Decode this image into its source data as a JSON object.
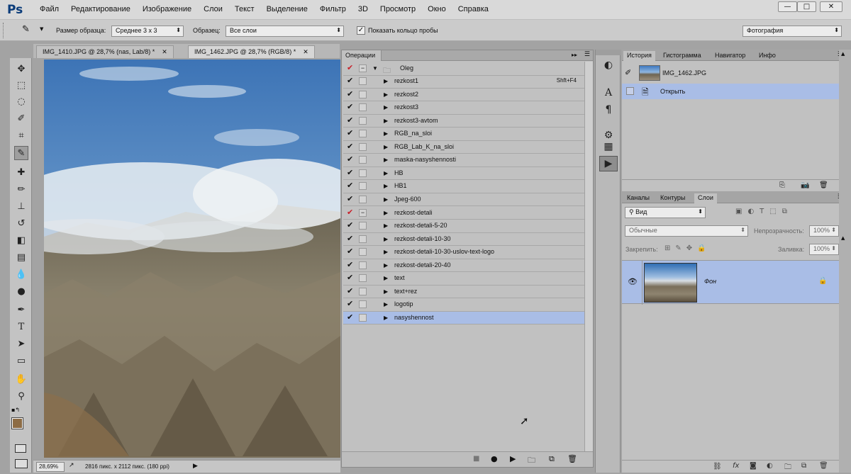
{
  "app": {
    "logo": "Ps"
  },
  "menu": [
    "Файл",
    "Редактирование",
    "Изображение",
    "Слои",
    "Текст",
    "Выделение",
    "Фильтр",
    "3D",
    "Просмотр",
    "Окно",
    "Справка"
  ],
  "window_controls": [
    "—",
    "□",
    "✕"
  ],
  "options": {
    "sample_size_label": "Размер образца:",
    "sample_size_value": "Среднее 3 x 3",
    "sample_label": "Образец:",
    "sample_value": "Все слои",
    "show_ring_label": "Показать кольцо пробы",
    "workspace": "Фотография"
  },
  "doc_tabs": [
    {
      "label": "IMG_1410.JPG @ 28,7% (nas, Lab/8) *",
      "active": false
    },
    {
      "label": "IMG_1462.JPG @ 28,7% (RGB/8) *",
      "active": true
    }
  ],
  "status": {
    "zoom": "28,69%",
    "info": "2816 пикс. x 2112 пикс. (180 ppi)"
  },
  "actions": {
    "title": "Операции",
    "set_name": "Oleg",
    "items": [
      {
        "name": "rezkost1",
        "shortcut": "Shft+F4",
        "check": "✔",
        "dialog": ""
      },
      {
        "name": "rezkost2",
        "shortcut": "",
        "check": "✔",
        "dialog": ""
      },
      {
        "name": "rezkost3",
        "shortcut": "",
        "check": "✔",
        "dialog": ""
      },
      {
        "name": "rezkost3-avtom",
        "shortcut": "",
        "check": "✔",
        "dialog": ""
      },
      {
        "name": "RGB_na_sloi",
        "shortcut": "",
        "check": "✔",
        "dialog": ""
      },
      {
        "name": "RGB_Lab_K_na_sloi",
        "shortcut": "",
        "check": "✔",
        "dialog": ""
      },
      {
        "name": "maska-nasyshennosti",
        "shortcut": "",
        "check": "✔",
        "dialog": ""
      },
      {
        "name": "HB",
        "shortcut": "",
        "check": "✔",
        "dialog": ""
      },
      {
        "name": "HB1",
        "shortcut": "",
        "check": "✔",
        "dialog": ""
      },
      {
        "name": "Jpeg-600",
        "shortcut": "",
        "check": "✔",
        "dialog": ""
      },
      {
        "name": "rezkost-detali",
        "shortcut": "",
        "check": "✔",
        "dialog": "−",
        "red": true
      },
      {
        "name": "rezkost-detali-5-20",
        "shortcut": "",
        "check": "✔",
        "dialog": ""
      },
      {
        "name": "rezkost-detali-10-30",
        "shortcut": "",
        "check": "✔",
        "dialog": ""
      },
      {
        "name": "rezkost-detali-10-30-uslov-text-logo",
        "shortcut": "",
        "check": "✔",
        "dialog": ""
      },
      {
        "name": "rezkost-detali-20-40",
        "shortcut": "",
        "check": "✔",
        "dialog": ""
      },
      {
        "name": "text",
        "shortcut": "",
        "check": "✔",
        "dialog": ""
      },
      {
        "name": "text+rez",
        "shortcut": "",
        "check": "✔",
        "dialog": ""
      },
      {
        "name": "logotip",
        "shortcut": "",
        "check": "✔",
        "dialog": ""
      },
      {
        "name": "nasyshennost",
        "shortcut": "",
        "check": "✔",
        "dialog": "",
        "selected": true
      }
    ]
  },
  "history": {
    "tabs": [
      "История",
      "Гистограмма",
      "Навигатор",
      "Инфо"
    ],
    "snapshot": "IMG_1462.JPG",
    "state": "Открыть"
  },
  "layers": {
    "tabs": [
      "Каналы",
      "Контуры",
      "Слои"
    ],
    "filter": "Вид",
    "blend": "Обычные",
    "opacity_label": "Непрозрачность:",
    "opacity": "100%",
    "lock_label": "Закрепить:",
    "fill_label": "Заливка:",
    "fill": "100%",
    "layer_name": "Фон"
  },
  "colors": {
    "accent_selection": "#a9bde6",
    "red_check": "#c8202a"
  }
}
